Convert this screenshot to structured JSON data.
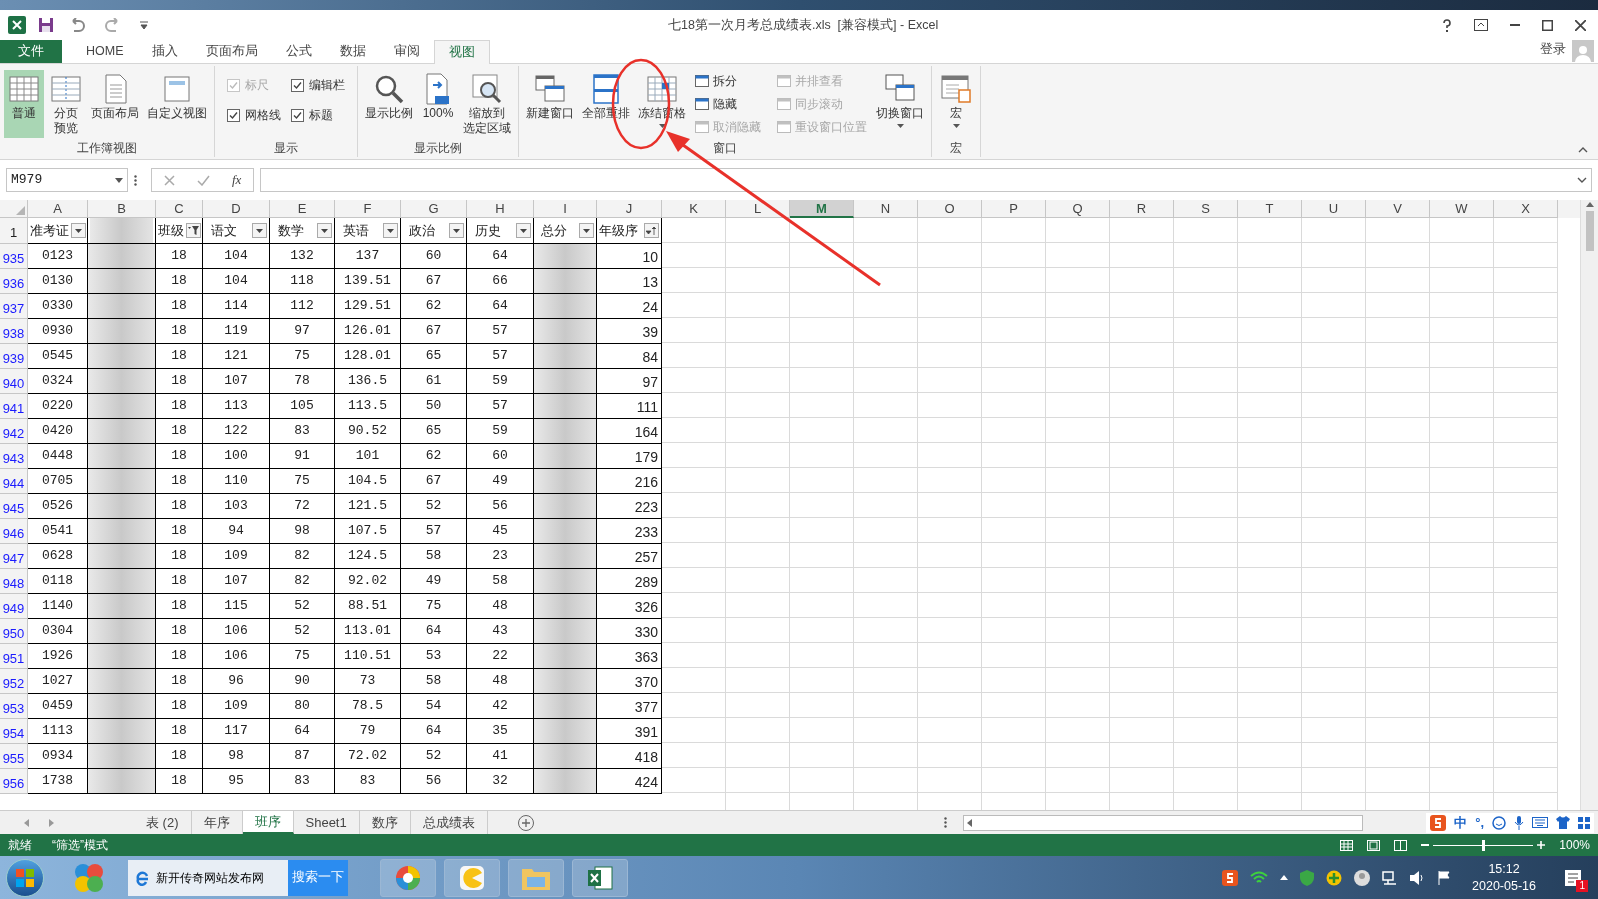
{
  "window": {
    "title": "七18第一次月考总成绩表.xls  [兼容模式] - Excel",
    "sign_in": "登录"
  },
  "ribbon_tabs": [
    {
      "label": "文件",
      "kind": "file",
      "selected": false
    },
    {
      "label": "HOME",
      "kind": "tab",
      "selected": false
    },
    {
      "label": "插入",
      "kind": "tab",
      "selected": false
    },
    {
      "label": "页面布局",
      "kind": "tab",
      "selected": false
    },
    {
      "label": "公式",
      "kind": "tab",
      "selected": false
    },
    {
      "label": "数据",
      "kind": "tab",
      "selected": false
    },
    {
      "label": "审阅",
      "kind": "tab",
      "selected": false
    },
    {
      "label": "视图",
      "kind": "tab",
      "selected": true
    }
  ],
  "ribbon_groups": [
    {
      "title": "工作簿视图",
      "items": [
        {
          "kind": "large",
          "lines": [
            "普通"
          ],
          "selected": true,
          "dropdown": false
        },
        {
          "kind": "large",
          "lines": [
            "分页",
            "预览"
          ],
          "selected": false,
          "dropdown": false
        },
        {
          "kind": "large",
          "lines": [
            "页面布局"
          ],
          "selected": false,
          "dropdown": false
        },
        {
          "kind": "large",
          "lines": [
            "自定义视图"
          ],
          "selected": false,
          "dropdown": false
        }
      ]
    },
    {
      "title": "显示",
      "items": [
        {
          "kind": "check",
          "label": "标尺",
          "checked": true,
          "disabled": true
        },
        {
          "kind": "check",
          "label": "编辑栏",
          "checked": true,
          "disabled": false
        },
        {
          "kind": "check",
          "label": "网格线",
          "checked": true,
          "disabled": false
        },
        {
          "kind": "check",
          "label": "标题",
          "checked": true,
          "disabled": false
        }
      ]
    },
    {
      "title": "显示比例",
      "items": [
        {
          "kind": "large",
          "lines": [
            "显示比例"
          ],
          "selected": false,
          "dropdown": false
        },
        {
          "kind": "large",
          "lines": [
            "100%"
          ],
          "selected": false,
          "dropdown": false
        },
        {
          "kind": "large",
          "lines": [
            "缩放到",
            "选定区域"
          ],
          "selected": false,
          "dropdown": false
        }
      ]
    },
    {
      "title": "窗口",
      "items": [
        {
          "kind": "large",
          "lines": [
            "新建窗口"
          ],
          "selected": false,
          "dropdown": false
        },
        {
          "kind": "large",
          "lines": [
            "全部重排"
          ],
          "selected": false,
          "dropdown": false
        },
        {
          "kind": "large",
          "lines": [
            "冻结窗格"
          ],
          "selected": false,
          "dropdown": true
        },
        {
          "kind": "small",
          "label": "拆分",
          "disabled": false
        },
        {
          "kind": "small",
          "label": "隐藏",
          "disabled": false
        },
        {
          "kind": "small",
          "label": "取消隐藏",
          "disabled": true
        },
        {
          "kind": "small",
          "label": "并排查看",
          "disabled": true
        },
        {
          "kind": "small",
          "label": "同步滚动",
          "disabled": true
        },
        {
          "kind": "small",
          "label": "重设窗口位置",
          "disabled": true
        },
        {
          "kind": "large",
          "lines": [
            "切换窗口"
          ],
          "selected": false,
          "dropdown": true
        }
      ]
    },
    {
      "title": "宏",
      "items": [
        {
          "kind": "large",
          "lines": [
            "宏"
          ],
          "selected": false,
          "dropdown": true
        }
      ]
    }
  ],
  "formula_bar": {
    "name_box": "M979",
    "function_label": "fx"
  },
  "column_headers": [
    {
      "label": "A",
      "selected": false
    },
    {
      "label": "B",
      "selected": false
    },
    {
      "label": "C",
      "selected": false
    },
    {
      "label": "D",
      "selected": false
    },
    {
      "label": "E",
      "selected": false
    },
    {
      "label": "F",
      "selected": false
    },
    {
      "label": "G",
      "selected": false
    },
    {
      "label": "H",
      "selected": false
    },
    {
      "label": "I",
      "selected": false
    },
    {
      "label": "J",
      "selected": false
    },
    {
      "label": "K",
      "selected": false
    },
    {
      "label": "L",
      "selected": false
    },
    {
      "label": "M",
      "selected": true
    },
    {
      "label": "N",
      "selected": false
    },
    {
      "label": "O",
      "selected": false
    },
    {
      "label": "P",
      "selected": false
    },
    {
      "label": "Q",
      "selected": false
    },
    {
      "label": "R",
      "selected": false
    },
    {
      "label": "S",
      "selected": false
    },
    {
      "label": "T",
      "selected": false
    },
    {
      "label": "U",
      "selected": false
    },
    {
      "label": "V",
      "selected": false
    },
    {
      "label": "W",
      "selected": false
    },
    {
      "label": "X",
      "selected": false
    }
  ],
  "header_row": {
    "number": "1",
    "columns": [
      {
        "header": "准考证",
        "kind": "dropdown"
      },
      {
        "kind": "blurred"
      },
      {
        "header": "班级",
        "kind": "filtered"
      },
      {
        "header": "语文",
        "kind": "dropdown"
      },
      {
        "header": "数学",
        "kind": "dropdown"
      },
      {
        "header": "英语",
        "kind": "dropdown"
      },
      {
        "header": "政治",
        "kind": "dropdown"
      },
      {
        "header": "历史",
        "kind": "dropdown"
      },
      {
        "header": "总分",
        "kind": "blurred"
      },
      {
        "header": "年级序",
        "kind": "sorted"
      }
    ]
  },
  "rows": [
    {
      "number": "935",
      "cells": [
        "0123",
        "18",
        "104",
        "132",
        "137",
        "60",
        "64",
        "10"
      ]
    },
    {
      "number": "936",
      "cells": [
        "0130",
        "18",
        "104",
        "118",
        "139.51",
        "67",
        "66",
        "13"
      ]
    },
    {
      "number": "937",
      "cells": [
        "0330",
        "18",
        "114",
        "112",
        "129.51",
        "62",
        "64",
        "24"
      ]
    },
    {
      "number": "938",
      "cells": [
        "0930",
        "18",
        "119",
        "97",
        "126.01",
        "67",
        "57",
        "39"
      ]
    },
    {
      "number": "939",
      "cells": [
        "0545",
        "18",
        "121",
        "75",
        "128.01",
        "65",
        "57",
        "84"
      ]
    },
    {
      "number": "940",
      "cells": [
        "0324",
        "18",
        "107",
        "78",
        "136.5",
        "61",
        "59",
        "97"
      ]
    },
    {
      "number": "941",
      "cells": [
        "0220",
        "18",
        "113",
        "105",
        "113.5",
        "50",
        "57",
        "111"
      ]
    },
    {
      "number": "942",
      "cells": [
        "0420",
        "18",
        "122",
        "83",
        "90.52",
        "65",
        "59",
        "164"
      ]
    },
    {
      "number": "943",
      "cells": [
        "0448",
        "18",
        "100",
        "91",
        "101",
        "62",
        "60",
        "179"
      ]
    },
    {
      "number": "944",
      "cells": [
        "0705",
        "18",
        "110",
        "75",
        "104.5",
        "67",
        "49",
        "216"
      ]
    },
    {
      "number": "945",
      "cells": [
        "0526",
        "18",
        "103",
        "72",
        "121.5",
        "52",
        "56",
        "223"
      ]
    },
    {
      "number": "946",
      "cells": [
        "0541",
        "18",
        "94",
        "98",
        "107.5",
        "57",
        "45",
        "233"
      ]
    },
    {
      "number": "947",
      "cells": [
        "0628",
        "18",
        "109",
        "82",
        "124.5",
        "58",
        "23",
        "257"
      ]
    },
    {
      "number": "948",
      "cells": [
        "0118",
        "18",
        "107",
        "82",
        "92.02",
        "49",
        "58",
        "289"
      ]
    },
    {
      "number": "949",
      "cells": [
        "1140",
        "18",
        "115",
        "52",
        "88.51",
        "75",
        "48",
        "326"
      ]
    },
    {
      "number": "950",
      "cells": [
        "0304",
        "18",
        "106",
        "52",
        "113.01",
        "64",
        "43",
        "330"
      ]
    },
    {
      "number": "951",
      "cells": [
        "1926",
        "18",
        "106",
        "75",
        "110.51",
        "53",
        "22",
        "363"
      ]
    },
    {
      "number": "952",
      "cells": [
        "1027",
        "18",
        "96",
        "90",
        "73",
        "58",
        "48",
        "370"
      ]
    },
    {
      "number": "953",
      "cells": [
        "0459",
        "18",
        "109",
        "80",
        "78.5",
        "54",
        "42",
        "377"
      ]
    },
    {
      "number": "954",
      "cells": [
        "1113",
        "18",
        "117",
        "64",
        "79",
        "64",
        "35",
        "391"
      ]
    },
    {
      "number": "955",
      "cells": [
        "0934",
        "18",
        "98",
        "87",
        "72.02",
        "52",
        "41",
        "418"
      ]
    },
    {
      "number": "956",
      "cells": [
        "1738",
        "18",
        "95",
        "83",
        "83",
        "56",
        "32",
        "424"
      ]
    }
  ],
  "sheet_tabs": [
    {
      "label": "表 (2)",
      "selected": false
    },
    {
      "label": "年序",
      "selected": false
    },
    {
      "label": "班序",
      "selected": true
    },
    {
      "label": "Sheet1",
      "selected": false
    },
    {
      "label": "数序",
      "selected": false
    },
    {
      "label": "总成绩表",
      "selected": false
    }
  ],
  "ime_toolbar": {
    "mode": "中",
    "punctuation": "°,"
  },
  "status_bar": {
    "items": [
      "就绪",
      "“筛选”模式"
    ],
    "zoom": "100%",
    "zoom_slider": {
      "level": 0.5
    }
  },
  "taskbar": {
    "search_value": "新开传奇网站发布网",
    "search_button": "搜索一下",
    "time": "15:12",
    "date": "2020-05-16",
    "notification_count": "1"
  }
}
